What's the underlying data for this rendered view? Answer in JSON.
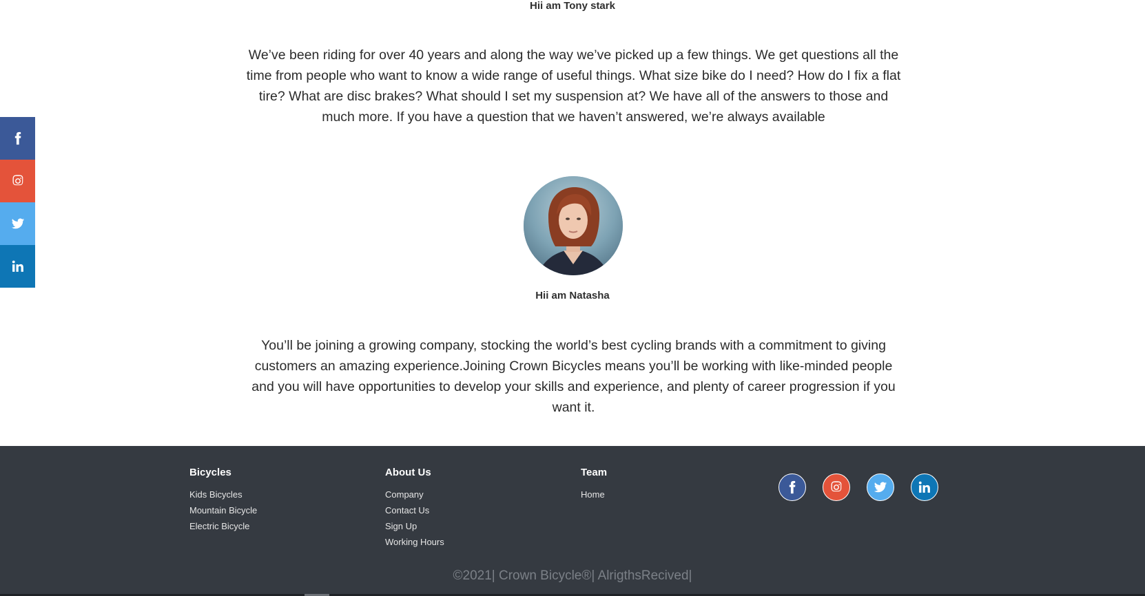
{
  "side_social": [
    {
      "icon": "facebook-icon",
      "color": "#3b5998"
    },
    {
      "icon": "instagram-icon",
      "color": "#e4533a"
    },
    {
      "icon": "twitter-icon",
      "color": "#55acee"
    },
    {
      "icon": "linkedin-icon",
      "color": "#0e76b5"
    }
  ],
  "testimonials": [
    {
      "name": "Hii am Tony stark",
      "text": "We’ve been riding for over 40 years and along the way we’ve picked up a few things. We get questions all the time from people who want to know a wide range of useful things. What size bike do I need? How do I fix a flat tire? What are disc brakes? What should I set my suspension at? We have all of the answers to those and much more. If you have a question that we haven’t answered, we’re always available"
    },
    {
      "name": "Hii am Natasha",
      "text": "You’ll be joining a growing company, stocking the world’s best cycling brands with a commitment to giving customers an amazing experience.Joining Crown Bicycles means you’ll be working with like-minded people and you will have opportunities to develop your skills and experience, and plenty of career progression if you want it."
    }
  ],
  "footer": {
    "columns": [
      {
        "title": "Bicycles",
        "links": [
          "Kids Bicycles",
          "Mountain Bicycle",
          "Electric Bicycle"
        ]
      },
      {
        "title": "About Us",
        "links": [
          "Company",
          "Contact Us",
          "Sign Up",
          "Working Hours"
        ]
      },
      {
        "title": "Team",
        "links": [
          "Home"
        ]
      }
    ],
    "social": [
      {
        "icon": "facebook-icon",
        "color": "#3b5998"
      },
      {
        "icon": "instagram-icon",
        "color": "#e4533a"
      },
      {
        "icon": "twitter-icon",
        "color": "#55acee"
      },
      {
        "icon": "linkedin-icon",
        "color": "#0e76b5"
      }
    ],
    "copyright": "©2021| Crown Bicycle®| AlrigthsRecived|"
  }
}
